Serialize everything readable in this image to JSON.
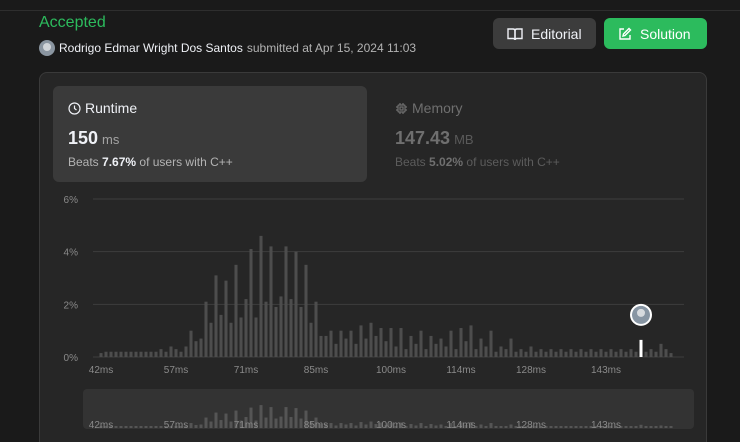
{
  "submission": {
    "status": "Accepted",
    "author": "Rodrigo Edmar Wright Dos Santos",
    "submitted_text": "submitted at Apr 15, 2024 11:03"
  },
  "buttons": {
    "editorial": "Editorial",
    "solution": "Solution"
  },
  "runtime": {
    "title": "Runtime",
    "value": "150",
    "unit": "ms",
    "beats_prefix": "Beats",
    "beats_pct": "7.67%",
    "beats_suffix": "of users with C++"
  },
  "memory": {
    "title": "Memory",
    "value": "147.43",
    "unit": "MB",
    "beats_prefix": "Beats",
    "beats_pct": "5.02%",
    "beats_suffix": "of users with C++"
  },
  "colors": {
    "accepted": "#2cbb5d",
    "solution_button": "#2cbb5d",
    "bar": "#4d4d4d",
    "highlight_bar": "#ffffff"
  },
  "chart_data": {
    "type": "bar",
    "ylim": [
      0,
      6
    ],
    "y_ticks": [
      "0%",
      "2%",
      "4%",
      "6%"
    ],
    "y_tick_values": [
      0,
      2,
      4,
      6
    ],
    "x_ticks": [
      "42ms",
      "57ms",
      "71ms",
      "85ms",
      "100ms",
      "114ms",
      "128ms",
      "143ms"
    ],
    "x_tick_values": [
      42,
      57,
      71,
      85,
      100,
      114,
      128,
      143
    ],
    "xlim": [
      42,
      157
    ],
    "highlight_x": 150,
    "x": [
      42,
      43,
      44,
      45,
      46,
      47,
      48,
      49,
      50,
      51,
      52,
      53,
      54,
      55,
      56,
      57,
      58,
      59,
      60,
      61,
      62,
      63,
      64,
      65,
      66,
      67,
      68,
      69,
      70,
      71,
      72,
      73,
      74,
      75,
      76,
      77,
      78,
      79,
      80,
      81,
      82,
      83,
      84,
      85,
      86,
      87,
      88,
      89,
      90,
      91,
      92,
      93,
      94,
      95,
      96,
      97,
      98,
      99,
      100,
      101,
      102,
      103,
      104,
      105,
      106,
      107,
      108,
      109,
      110,
      111,
      112,
      113,
      114,
      115,
      116,
      117,
      118,
      119,
      120,
      121,
      122,
      123,
      124,
      125,
      126,
      127,
      128,
      129,
      130,
      131,
      132,
      133,
      134,
      135,
      136,
      137,
      138,
      139,
      140,
      141,
      142,
      143,
      144,
      145,
      146,
      147,
      148,
      149,
      150,
      151,
      152,
      153,
      154,
      155,
      156
    ],
    "values": [
      0.15,
      0.2,
      0.2,
      0.2,
      0.2,
      0.2,
      0.2,
      0.2,
      0.2,
      0.2,
      0.2,
      0.2,
      0.3,
      0.2,
      0.4,
      0.3,
      0.2,
      0.4,
      1.0,
      0.6,
      0.7,
      2.1,
      1.3,
      3.1,
      1.6,
      2.9,
      1.3,
      3.5,
      1.5,
      2.2,
      4.1,
      1.5,
      4.6,
      2.1,
      4.2,
      1.9,
      2.3,
      4.2,
      2.2,
      4.0,
      1.9,
      3.5,
      1.3,
      2.1,
      0.8,
      0.8,
      1.0,
      0.5,
      1.0,
      0.7,
      1.0,
      0.5,
      1.2,
      0.7,
      1.3,
      0.8,
      1.1,
      0.6,
      1.1,
      0.4,
      1.1,
      0.3,
      0.8,
      0.5,
      1.0,
      0.3,
      0.8,
      0.5,
      0.7,
      0.4,
      1.0,
      0.3,
      1.1,
      0.6,
      1.2,
      0.3,
      0.7,
      0.4,
      1.0,
      0.2,
      0.4,
      0.3,
      0.7,
      0.2,
      0.3,
      0.2,
      0.4,
      0.2,
      0.3,
      0.2,
      0.3,
      0.2,
      0.3,
      0.2,
      0.3,
      0.2,
      0.3,
      0.2,
      0.3,
      0.2,
      0.3,
      0.2,
      0.3,
      0.2,
      0.3,
      0.2,
      0.3,
      0.2,
      0.65,
      0.2,
      0.3,
      0.2,
      0.5,
      0.3,
      0.15
    ]
  }
}
